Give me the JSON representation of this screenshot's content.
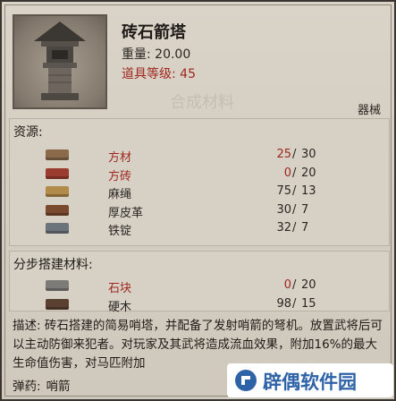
{
  "item": {
    "name": "砖石箭塔",
    "weight_label": "重量: 20.00",
    "level_label": "道具等级: 45",
    "category": "器械",
    "watermark": "合成材料"
  },
  "resources": {
    "title": "资源:",
    "rows": [
      {
        "icon": "lumber-icon",
        "name": "方材",
        "have": "25",
        "need": "30",
        "insufficient": true
      },
      {
        "icon": "brick-icon",
        "name": "方砖",
        "have": "0",
        "need": "20",
        "insufficient": true
      },
      {
        "icon": "rope-icon",
        "name": "麻绳",
        "have": "75",
        "need": "13",
        "insufficient": false
      },
      {
        "icon": "leather-icon",
        "name": "厚皮革",
        "have": "30",
        "need": "7",
        "insufficient": false
      },
      {
        "icon": "ingot-icon",
        "name": "铁锭",
        "have": "32",
        "need": "7",
        "insufficient": false
      }
    ]
  },
  "build": {
    "title": "分步搭建材料:",
    "rows": [
      {
        "icon": "stone-block-icon",
        "name": "石块",
        "have": "0",
        "need": "20",
        "insufficient": true
      },
      {
        "icon": "hardwood-icon",
        "name": "硬木",
        "have": "98",
        "need": "15",
        "insufficient": false
      }
    ]
  },
  "description": "描述: 砖石搭建的简易哨塔，并配备了发射哨箭的弩机。放置武将后可以主动防御来犯者。对玩家及其武将造成流血效果，附加16%的最大生命值伤害，对马匹附加",
  "ammo": {
    "label": "弹药:",
    "value": "哨箭"
  },
  "brand": {
    "text": "辟偶软件园"
  },
  "colors": {
    "insufficient": "#a0271f",
    "normal": "#2a2622",
    "panel": "#d9d3c8",
    "brand": "#2f63a7"
  }
}
